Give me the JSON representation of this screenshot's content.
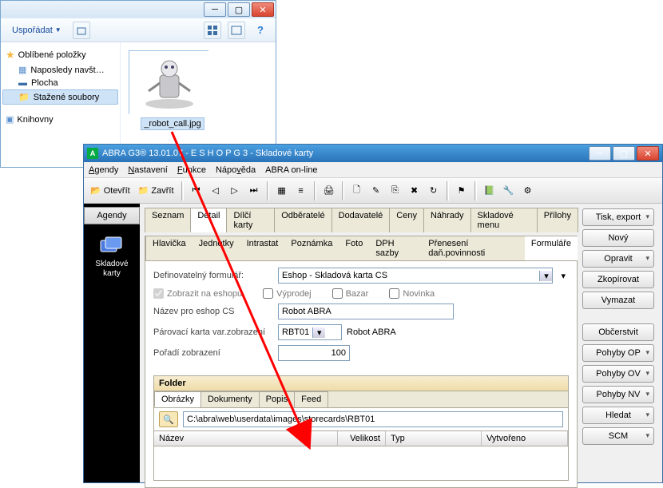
{
  "explorer": {
    "toolbar": {
      "organize": "Uspořádat"
    },
    "nav": {
      "favorites": "Oblíbené položky",
      "recent": "Naposledy navšt…",
      "desktop": "Plocha",
      "downloads": "Stažené soubory",
      "libraries": "Knihovny"
    },
    "file": {
      "name": "_robot_call.jpg"
    }
  },
  "abra": {
    "title": "ABRA G3® 13.01.07 -  E S H O P   G 3 - Skladové karty",
    "menu": {
      "agendy": "Agendy",
      "nastaveni": "Nastavení",
      "funkce": "Funkce",
      "napoveda": "Nápověda",
      "online": "ABRA on-line"
    },
    "toolbar": {
      "open": "Otevřít",
      "close": "Zavřít"
    },
    "left": {
      "agendy": "Agendy",
      "skladove": "Skladové\nkarty"
    },
    "tabs1": {
      "seznam": "Seznam",
      "detail": "Detail",
      "dilci": "Dílčí karty",
      "odberatele": "Odběratelé",
      "dodavatele": "Dodavatelé",
      "ceny": "Ceny",
      "nahrady": "Náhrady",
      "sklmenu": "Skladové menu",
      "prilohy": "Přílohy"
    },
    "tabs2": {
      "hlavicka": "Hlavička",
      "jednotky": "Jednotky",
      "intrastat": "Intrastat",
      "poznamka": "Poznámka",
      "foto": "Foto",
      "dph": "DPH sazby",
      "prenes": "Přenesení daň.povinnosti",
      "formulare": "Formuláře"
    },
    "form": {
      "defform_label": "Definovatelný formulář:",
      "defform_value": "Eshop - Skladová karta CS",
      "zobrazit": "Zobrazit na eshopu",
      "vyprodej": "Výprodej",
      "bazar": "Bazar",
      "novinka": "Novinka",
      "nazev_label": "Název pro eshop CS",
      "nazev_value": "Robot ABRA",
      "parovaci_label": "Párovací karta var.zobrazení",
      "parovaci_code": "RBT01",
      "parovaci_text": "Robot ABRA",
      "poradi_label": "Pořadí zobrazení",
      "poradi_value": "100"
    },
    "folder": {
      "title": "Folder",
      "tabs": {
        "obrazky": "Obrázky",
        "dokumenty": "Dokumenty",
        "popis": "Popis",
        "feed": "Feed"
      },
      "path": "C:\\abra\\web\\userdata\\images\\storecards\\RBT01",
      "cols": {
        "nazev": "Název",
        "velikost": "Velikost",
        "typ": "Typ",
        "vytvoreno": "Vytvořeno"
      }
    },
    "buttons": {
      "tisk": "Tisk, export",
      "novy": "Nový",
      "opravit": "Opravit",
      "zkopirovat": "Zkopírovat",
      "vymazat": "Vymazat",
      "obcerstvit": "Občerstvit",
      "pop": "Pohyby OP",
      "pov": "Pohyby OV",
      "pnv": "Pohyby NV",
      "hledat": "Hledat",
      "scm": "SCM"
    }
  }
}
